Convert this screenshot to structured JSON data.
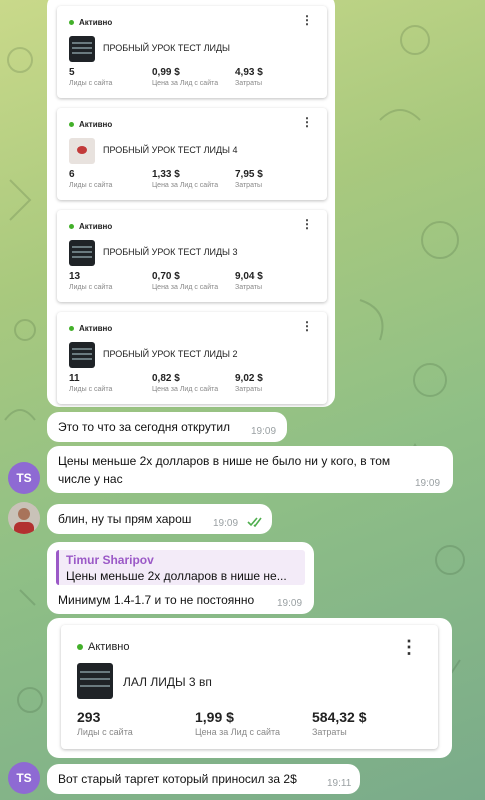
{
  "cards": [
    {
      "status": "Активно",
      "title": "ПРОБНЫЙ УРОК ТЕСТ ЛИДЫ",
      "leads": "5",
      "price": "0,99 $",
      "cost": "4,93 $"
    },
    {
      "status": "Активно",
      "title": "ПРОБНЫЙ УРОК ТЕСТ ЛИДЫ 4",
      "leads": "6",
      "price": "1,33 $",
      "cost": "7,95 $"
    },
    {
      "status": "Активно",
      "title": "ПРОБНЫЙ УРОК ТЕСТ ЛИДЫ 3",
      "leads": "13",
      "price": "0,70 $",
      "cost": "9,04 $"
    },
    {
      "status": "Активно",
      "title": "ПРОБНЫЙ УРОК ТЕСТ ЛИДЫ 2",
      "leads": "11",
      "price": "0,82 $",
      "cost": "9,02 $"
    }
  ],
  "labels": {
    "leads": "Лиды с сайта",
    "price": "Цена за Лид с сайта",
    "cost": "Затраты"
  },
  "messages": {
    "m1": {
      "text": "Это то что за сегодня открутил",
      "time": "19:09"
    },
    "m2": {
      "text_line1": "Цены меньше 2х долларов в нише не было ни у кого, в том",
      "text_line2": "числе у нас",
      "time": "19:09"
    },
    "m3": {
      "text": "блин, ну ты прям харош",
      "time": "19:09"
    },
    "m4": {
      "reply_name": "Timur Sharipov",
      "reply_text": "Цены меньше 2х долларов в нише не...",
      "text": "Минимум 1.4-1.7 и то не постоянно",
      "time": "19:09"
    },
    "m5_card": {
      "status": "Активно",
      "title": "ЛАЛ ЛИДЫ 3 вп",
      "leads": "293",
      "price": "1,99 $",
      "cost": "584,32 $"
    },
    "m6": {
      "text": "Вот старый таргет который приносил за 2$",
      "time": "19:11"
    }
  },
  "avatars": {
    "ts_initials": "TS"
  },
  "colors": {
    "online_dot": "#43b02a",
    "avatar_ts": "#8e6ad3",
    "reply_accent": "#9b59c7",
    "read_check": "#4fae4e"
  }
}
